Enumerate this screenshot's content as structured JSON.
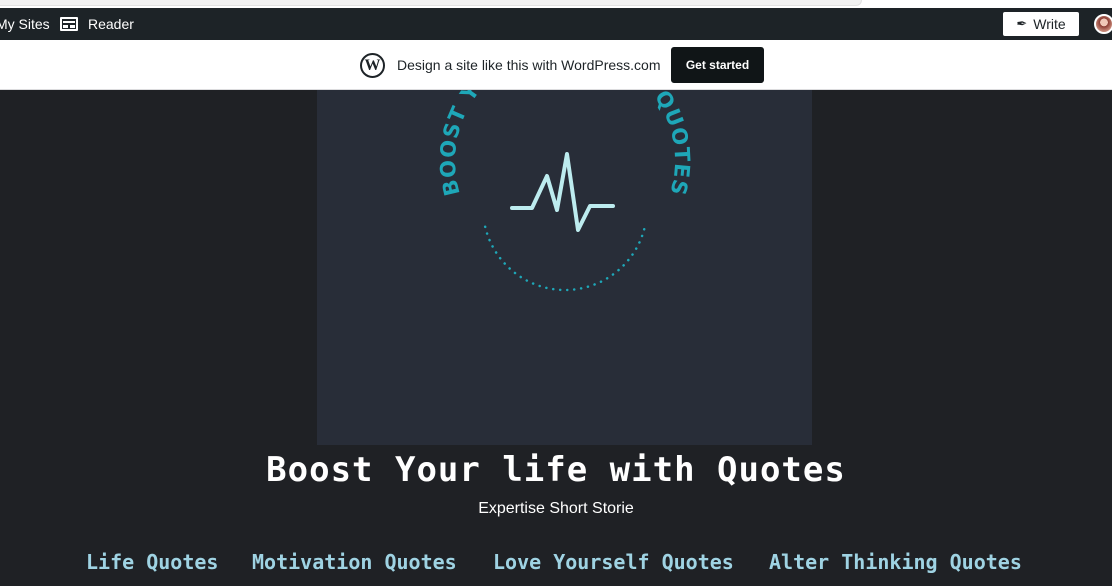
{
  "admin_bar": {
    "my_sites_label": "My Sites",
    "reader_label": "Reader",
    "write_label": "Write"
  },
  "promo": {
    "wp_logo_glyph": "W",
    "text": "Design a site like this with WordPress.com",
    "button_label": "Get started"
  },
  "site": {
    "logo_text": "BOOST YOUR LIFE WITH QUOTES",
    "title": "Boost Your life with Quotes",
    "tagline": "Expertise Short Storie"
  },
  "nav": {
    "items": [
      "Life Quotes",
      "Motivation Quotes",
      "Love Yourself Quotes",
      "Alter Thinking Quotes"
    ]
  },
  "colors": {
    "background": "#1f2125",
    "logo_panel": "#282d38",
    "logo_teal": "#1ea7b8",
    "pulse": "#bdecef",
    "nav_link": "#9fd3e3"
  }
}
